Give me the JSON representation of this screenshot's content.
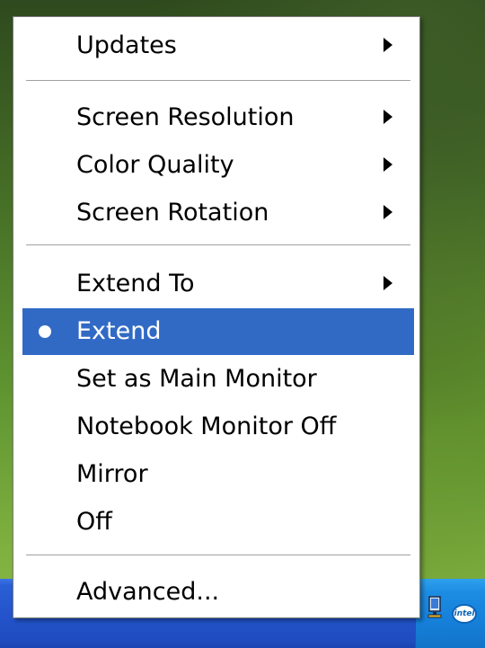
{
  "menu": {
    "items": [
      {
        "label": "Updates",
        "submenu": true
      },
      {
        "label": "Screen Resolution",
        "submenu": true
      },
      {
        "label": "Color Quality",
        "submenu": true
      },
      {
        "label": "Screen Rotation",
        "submenu": true
      },
      {
        "label": "Extend To",
        "submenu": true
      },
      {
        "label": "Extend",
        "selected": true,
        "checked": true
      },
      {
        "label": "Set as Main Monitor"
      },
      {
        "label": "Notebook Monitor Off"
      },
      {
        "label": "Mirror"
      },
      {
        "label": "Off"
      },
      {
        "label": "Advanced..."
      }
    ],
    "highlight_color": "#316ac5"
  },
  "taskbar": {
    "color": "#2454cc",
    "tray_color": "#1680da",
    "tray_icons": [
      "display-monitor-icon",
      "intel-graphics-icon"
    ],
    "intel_icon_text": "intel"
  }
}
